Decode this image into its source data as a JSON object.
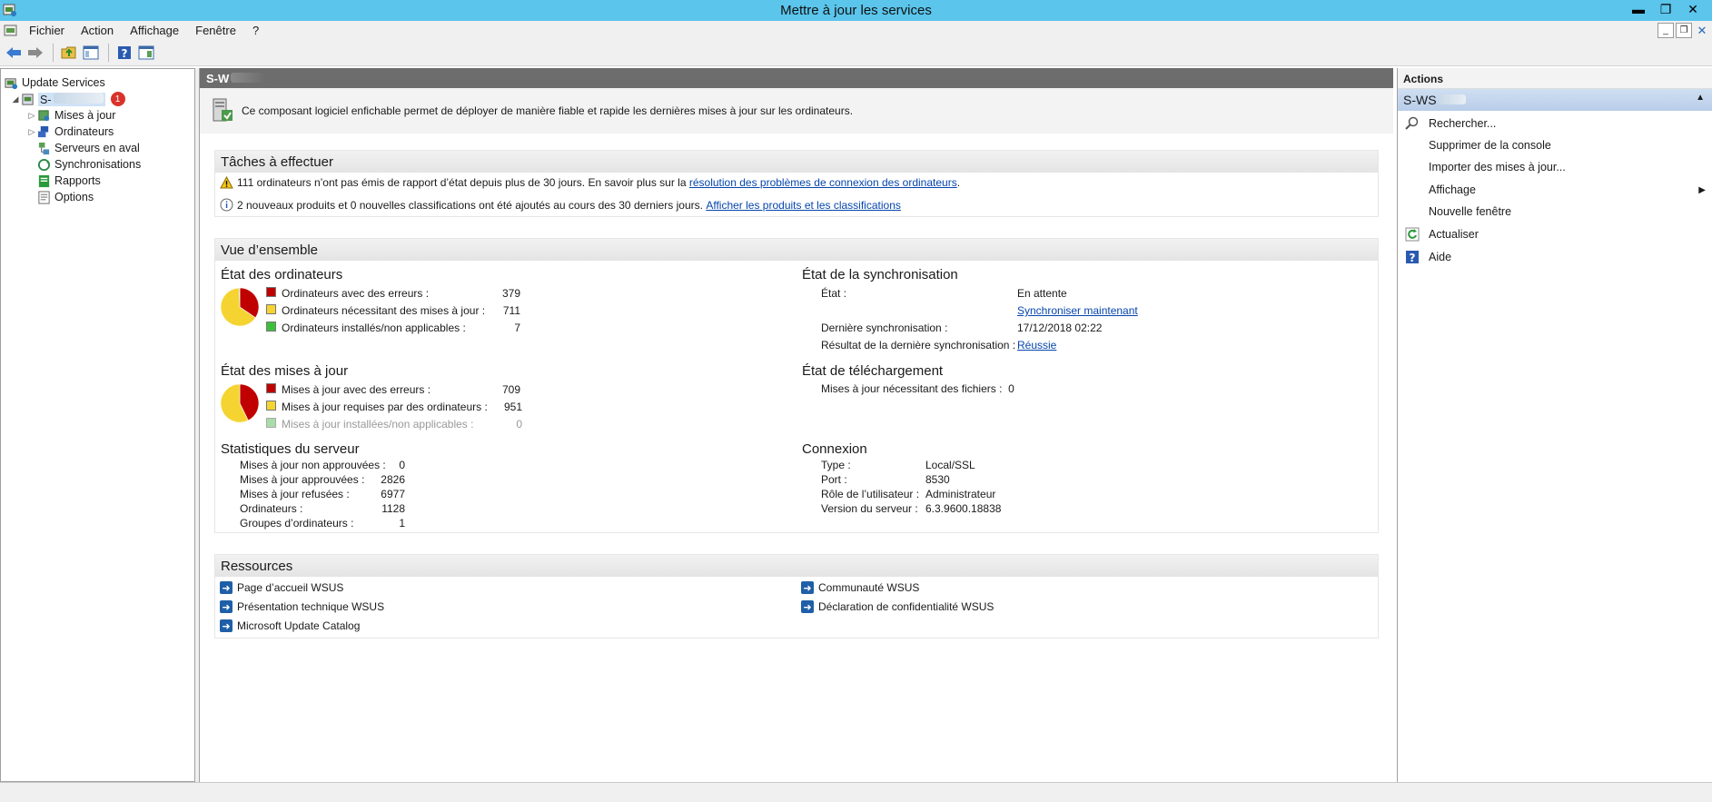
{
  "window": {
    "title": "Mettre à jour les services"
  },
  "menu": [
    "Fichier",
    "Action",
    "Affichage",
    "Fenêtre",
    "?"
  ],
  "tree": {
    "root": "Update Services",
    "server": "S-",
    "server_badge": "1",
    "children": [
      "Mises à jour",
      "Ordinateurs",
      "Serveurs en aval",
      "Synchronisations",
      "Rapports",
      "Options"
    ]
  },
  "center": {
    "header": "S-W",
    "intro": "Ce composant logiciel enfichable permet de déployer de manière fiable et rapide les dernières mises à jour sur les ordinateurs.",
    "tasks": {
      "title": "Tâches à effectuer",
      "t1_text": "111 ordinateurs n’ont pas émis de rapport d’état depuis plus de 30 jours. En savoir plus sur la",
      "t1_link": "résolution des problèmes de connexion des ordinateurs",
      "t1_end": ".",
      "t2_text": "2 nouveaux produits et 0 nouvelles classifications ont été ajoutés au cours des 30 derniers jours.",
      "t2_link": "Afficher les produits et les classifications"
    },
    "overview": {
      "title": "Vue d’ensemble",
      "computers": {
        "title": "État des ordinateurs",
        "items": [
          {
            "label": "Ordinateurs avec des erreurs :",
            "value": "379",
            "color": "#c00000"
          },
          {
            "label": "Ordinateurs nécessitant des mises à jour :",
            "value": "711",
            "color": "#f5d432"
          },
          {
            "label": "Ordinateurs installés/non applicables :",
            "value": "7",
            "color": "#3cc03c"
          }
        ]
      },
      "updates": {
        "title": "État des mises à jour",
        "items": [
          {
            "label": "Mises à jour avec des erreurs :",
            "value": "709",
            "color": "#c00000"
          },
          {
            "label": "Mises à jour requises par des ordinateurs :",
            "value": "951",
            "color": "#f5d432"
          },
          {
            "label": "Mises à jour installées/non applicables :",
            "value": "0",
            "color": "#a8dca8"
          }
        ]
      },
      "stats": {
        "title": "Statistiques du serveur",
        "items": [
          {
            "label": "Mises à jour non approuvées :",
            "value": "0"
          },
          {
            "label": "Mises à jour approuvées :",
            "value": "2826"
          },
          {
            "label": "Mises à jour refusées :",
            "value": "6977"
          },
          {
            "label": "Ordinateurs :",
            "value": "1128"
          },
          {
            "label": "Groupes d’ordinateurs :",
            "value": "1"
          }
        ]
      },
      "sync": {
        "title": "État de la synchronisation",
        "state_label": "État :",
        "state_value": "En attente",
        "sync_now": "Synchroniser maintenant",
        "last_label": "Dernière synchronisation :",
        "last_value": "17/12/2018 02:22",
        "result_label": "Résultat de la dernière synchronisation :",
        "result_value": "Réussie"
      },
      "download": {
        "title": "État de téléchargement",
        "label": "Mises à jour nécessitant des fichiers :",
        "value": "0"
      },
      "connection": {
        "title": "Connexion",
        "items": [
          {
            "label": "Type :",
            "value": "Local/SSL"
          },
          {
            "label": "Port :",
            "value": "8530"
          },
          {
            "label": "Rôle de l’utilisateur :",
            "value": "Administrateur"
          },
          {
            "label": "Version du serveur :",
            "value": "6.3.9600.18838"
          }
        ]
      }
    },
    "resources": {
      "title": "Ressources",
      "items": [
        "Page d’accueil WSUS",
        "Présentation technique WSUS",
        "Microsoft Update Catalog",
        "Communauté WSUS",
        "Déclaration de confidentialité WSUS"
      ]
    }
  },
  "actions": {
    "title": "Actions",
    "server": "S-WS",
    "items": [
      "Rechercher...",
      "Supprimer de la console",
      "Importer des mises à jour...",
      "Affichage",
      "Nouvelle fenêtre",
      "Actualiser",
      "Aide"
    ]
  },
  "chart_data": [
    {
      "type": "pie",
      "series": [
        {
          "values": [
            379,
            711,
            7
          ]
        }
      ]
    },
    {
      "type": "pie",
      "series": [
        {
          "values": [
            709,
            951,
            0
          ]
        }
      ]
    }
  ]
}
